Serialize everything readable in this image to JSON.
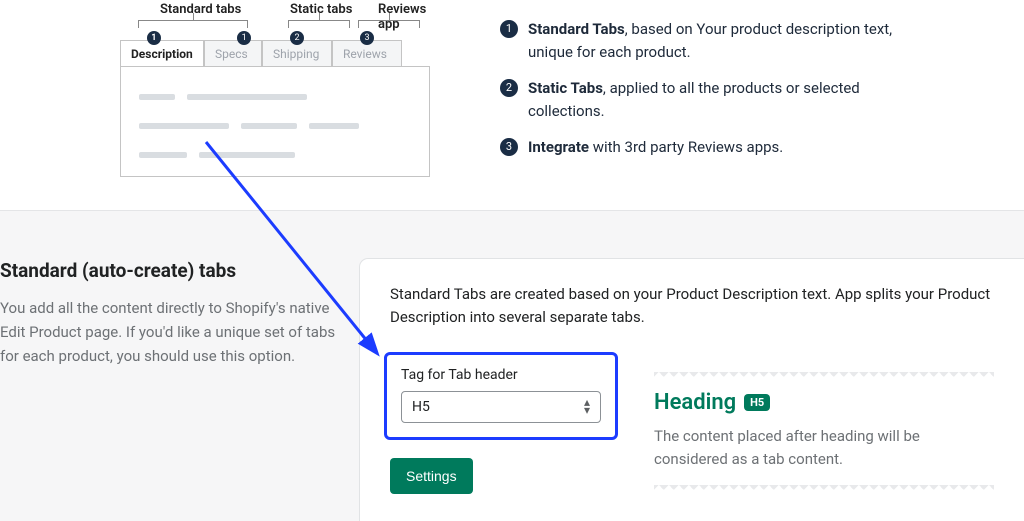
{
  "illus": {
    "annot": {
      "standard": "Standard tabs",
      "static": "Static tabs",
      "reviews": "Reviews app"
    },
    "tabs": [
      "Description",
      "Specs",
      "Shipping",
      "Reviews"
    ]
  },
  "features": [
    {
      "bold": "Standard Tabs",
      "rest": ", based on Your product description text, unique for each product."
    },
    {
      "bold": "Static Tabs",
      "rest": ", applied to all the products or selected collections."
    },
    {
      "bold": "Integrate",
      "rest": " with 3rd party Reviews apps."
    }
  ],
  "lower": {
    "title": "Standard (auto-create) tabs",
    "desc": "You add all the content directly to Shopify's native Edit Product page. If you'd like a unique set of tabs for each product, you should use this option.",
    "card": {
      "intro": "Standard Tabs are created based on your Product Description text. App splits your Product Description into several separate tabs.",
      "tag_label": "Tag for Tab header",
      "tag_value": "H5",
      "settings_btn": "Settings",
      "heading_word": "Heading",
      "heading_badge": "H5",
      "heading_desc": "The content placed after heading will be considered as a tab content."
    }
  }
}
